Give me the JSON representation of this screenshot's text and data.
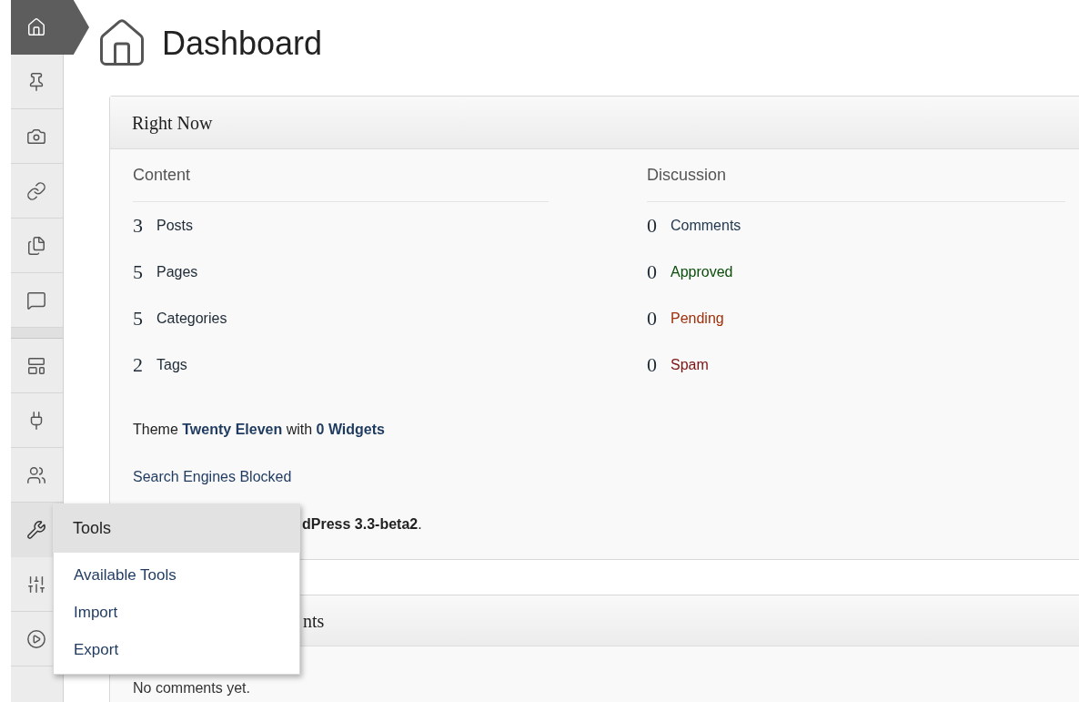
{
  "sidebar": {
    "items": [
      {
        "kind": "home",
        "selected": true,
        "hovered": false
      },
      {
        "kind": "pin",
        "selected": false,
        "hovered": false
      },
      {
        "kind": "media",
        "selected": false,
        "hovered": false
      },
      {
        "kind": "link",
        "selected": false,
        "hovered": false
      },
      {
        "kind": "pages",
        "selected": false,
        "hovered": false
      },
      {
        "kind": "comments",
        "selected": false,
        "hovered": false
      },
      {
        "kind": "separator"
      },
      {
        "kind": "appearance",
        "selected": false,
        "hovered": false
      },
      {
        "kind": "plugins",
        "selected": false,
        "hovered": false
      },
      {
        "kind": "users",
        "selected": false,
        "hovered": false
      },
      {
        "kind": "tools",
        "selected": false,
        "hovered": true
      },
      {
        "kind": "settings",
        "selected": false,
        "hovered": false
      },
      {
        "kind": "collapse",
        "selected": false,
        "hovered": false
      }
    ]
  },
  "flyout": {
    "title": "Tools",
    "items": [
      "Available Tools",
      "Import",
      "Export"
    ]
  },
  "page": {
    "title": "Dashboard"
  },
  "right_now": {
    "title": "Right Now",
    "content": {
      "heading": "Content",
      "rows": [
        {
          "count": "3",
          "label": "Posts"
        },
        {
          "count": "5",
          "label": "Pages"
        },
        {
          "count": "5",
          "label": "Categories"
        },
        {
          "count": "2",
          "label": "Tags"
        }
      ]
    },
    "discussion": {
      "heading": "Discussion",
      "rows": [
        {
          "count": "0",
          "label": "Comments",
          "color": "#21384f"
        },
        {
          "count": "0",
          "label": "Approved",
          "color": "#0a4d0a"
        },
        {
          "count": "0",
          "label": "Pending",
          "color": "#a0300b"
        },
        {
          "count": "0",
          "label": "Spam",
          "color": "#7a1212"
        }
      ]
    },
    "theme_line": "Theme **Twenty Eleven** with **0 Widgets**",
    "search_engines": "Search Engines Blocked",
    "version_line": "**dPress 3.3-beta2**."
  },
  "recent_comments": {
    "title": "nts",
    "empty_text": "No comments yet."
  }
}
